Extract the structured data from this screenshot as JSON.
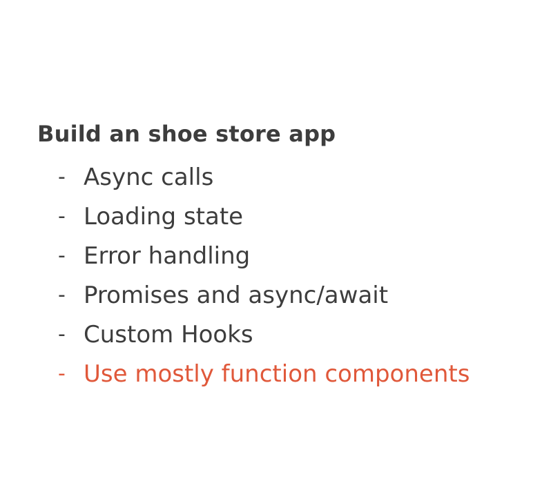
{
  "slide": {
    "heading": "Build an shoe store app",
    "bullets": [
      {
        "dash": "-",
        "text": "Async calls"
      },
      {
        "dash": "-",
        "text": "Loading state"
      },
      {
        "dash": "-",
        "text": "Error handling"
      },
      {
        "dash": "-",
        "text": "Promises and async/await"
      },
      {
        "dash": "-",
        "text": "Custom Hooks"
      },
      {
        "dash": "-",
        "text": "Use mostly function components"
      }
    ]
  },
  "colors": {
    "text": "#3d3d3d",
    "accent": "#e0583a",
    "background": "#ffffff"
  }
}
